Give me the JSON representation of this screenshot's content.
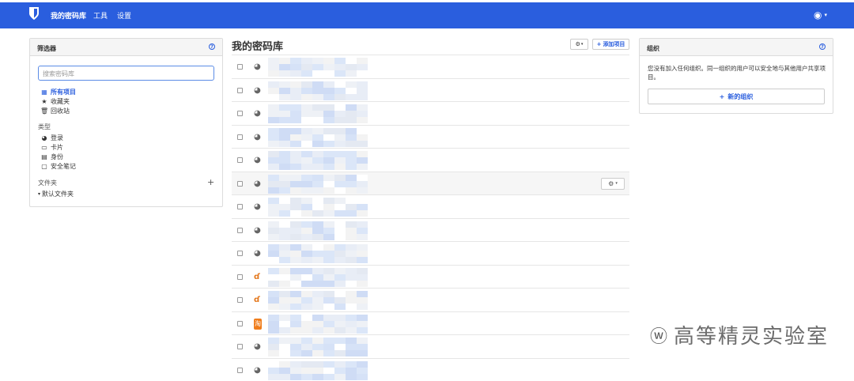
{
  "nav": {
    "links": [
      "我的密码库",
      "工具",
      "设置"
    ]
  },
  "filters": {
    "title": "筛选器",
    "search_placeholder": "搜索密码库",
    "main_items": [
      {
        "icon": "grid-icon",
        "glyph": "▦",
        "label": "所有项目"
      },
      {
        "icon": "star-icon",
        "glyph": "★",
        "label": "收藏夹"
      },
      {
        "icon": "trash-icon",
        "glyph": "🗑",
        "label": "回收站"
      }
    ],
    "types_title": "类型",
    "types": [
      {
        "icon": "globe-icon",
        "glyph": "◕",
        "label": "登录"
      },
      {
        "icon": "card-icon",
        "glyph": "▭",
        "label": "卡片"
      },
      {
        "icon": "id-card-icon",
        "glyph": "▤",
        "label": "身份"
      },
      {
        "icon": "note-icon",
        "glyph": "▢",
        "label": "安全笔记"
      }
    ],
    "folders_title": "文件夹",
    "folders": [
      {
        "label": "默认文件夹"
      }
    ]
  },
  "vault": {
    "title": "我的密码库",
    "add_label": "添加项目",
    "rows": [
      {
        "icon": "globe-icon",
        "glyph": "◕"
      },
      {
        "icon": "globe-icon",
        "glyph": "◕"
      },
      {
        "icon": "globe-icon",
        "glyph": "◕"
      },
      {
        "icon": "globe-icon",
        "glyph": "◕"
      },
      {
        "icon": "globe-icon",
        "glyph": "◕"
      },
      {
        "icon": "globe-icon",
        "glyph": "◕"
      },
      {
        "icon": "globe-icon",
        "glyph": "◕"
      },
      {
        "icon": "globe-icon",
        "glyph": "◕"
      },
      {
        "icon": "globe-icon",
        "glyph": "◕"
      },
      {
        "icon": "douban-icon",
        "glyph": "ɗ"
      },
      {
        "icon": "douban-icon",
        "glyph": "ɗ"
      },
      {
        "icon": "taobao-icon",
        "glyph": "淘"
      },
      {
        "icon": "globe-icon",
        "glyph": "◕"
      },
      {
        "icon": "globe-icon",
        "glyph": "◕"
      }
    ]
  },
  "org": {
    "title": "组织",
    "text": "您没有加入任何组织。同一组织的用户可以安全地与其他用户共享项目。",
    "new_label": "新的组织"
  },
  "watermark": "高等精灵实验室",
  "colors": {
    "brand": "#2a5ede"
  }
}
